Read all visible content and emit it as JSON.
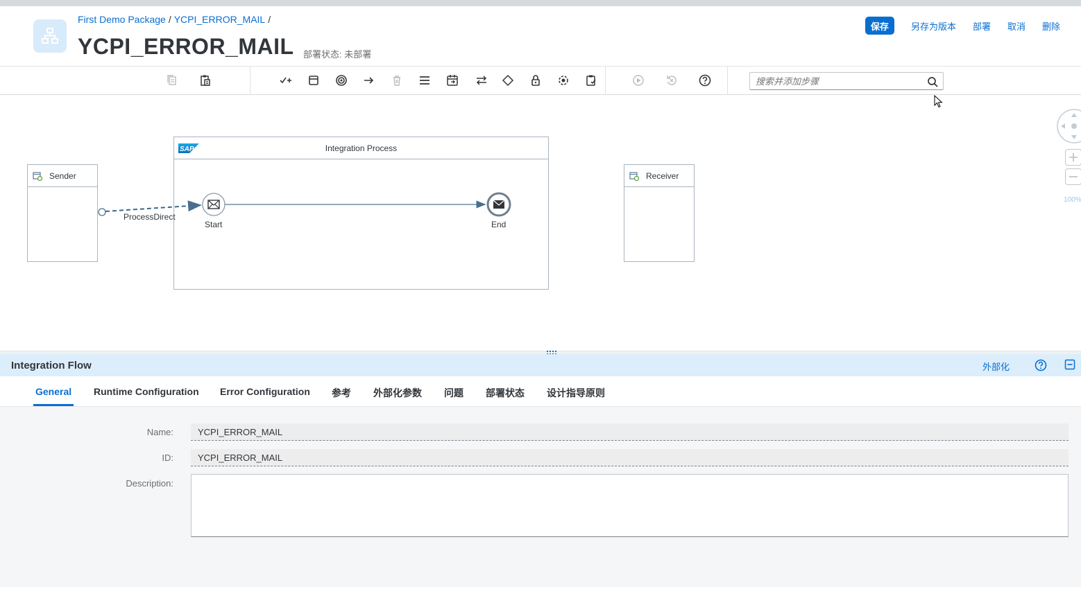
{
  "header": {
    "breadcrumb": [
      "First Demo Package",
      "YCPI_ERROR_MAIL"
    ],
    "breadcrumb_sep": "/",
    "title": "YCPI_ERROR_MAIL",
    "deploy_status": "部署状态: 未部署",
    "actions": {
      "save": "保存",
      "save_as_version": "另存为版本",
      "deploy": "部署",
      "cancel": "取消",
      "delete": "删除"
    }
  },
  "toolbar": {
    "icons": [
      "copy-icon",
      "paste-icon",
      "participants-icon",
      "process-icon",
      "events-icon",
      "connectors-icon",
      "delete-icon",
      "menu-icon",
      "call-icon",
      "routing-icon",
      "gateway-icon",
      "security-icon",
      "transformation-icon",
      "validation-icon",
      "simulate-icon",
      "reset-icon",
      "help-icon"
    ],
    "search_placeholder": "搜索并添加步骤"
  },
  "canvas": {
    "sender_label": "Sender",
    "receiver_label": "Receiver",
    "pool_title": "Integration Process",
    "sap_logo": "SAP",
    "start_label": "Start",
    "end_label": "End",
    "connection_label": "ProcessDirect",
    "zoom_level": "100%"
  },
  "panel": {
    "title": "Integration Flow",
    "externalize": "外部化",
    "tabs": [
      "General",
      "Runtime Configuration",
      "Error Configuration",
      "参考",
      "外部化参数",
      "问题",
      "部署状态",
      "设计指导原则"
    ],
    "active_tab": "General",
    "fields": {
      "name_label": "Name:",
      "name_value": "YCPI_ERROR_MAIL",
      "id_label": "ID:",
      "id_value": "YCPI_ERROR_MAIL",
      "description_label": "Description:",
      "description_value": ""
    }
  },
  "colors": {
    "accent": "#0a6ed1",
    "panel_header": "#dcedfb",
    "form_bg": "#f5f6f7"
  }
}
